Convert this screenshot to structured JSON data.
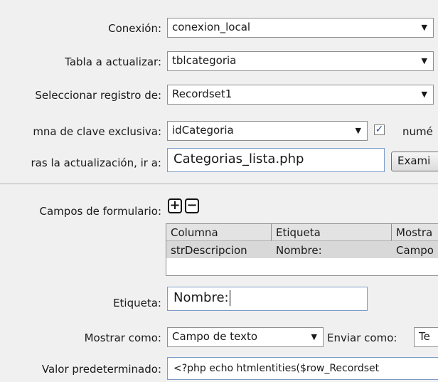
{
  "connection": {
    "label": "Conexión:",
    "value": "conexion_local"
  },
  "table": {
    "label": "Tabla a actualizar:",
    "value": "tblcategoria"
  },
  "recordset": {
    "label": "Seleccionar registro de:",
    "value": "Recordset1"
  },
  "key_column": {
    "label": "mna de clave exclusiva:",
    "value": "idCategoria",
    "numeric_label": "numé",
    "numeric_checked": true
  },
  "redirect": {
    "label": "ras la actualización, ir a:",
    "value": "Categorias_lista.php",
    "browse_label": "Exami"
  },
  "form_fields": {
    "label": "Campos de formulario:",
    "add_icon": "plus-icon",
    "remove_icon": "minus-icon",
    "columns": [
      "Columna",
      "Etiqueta",
      "Mostra"
    ],
    "rows": [
      [
        "strDescripcion",
        "Nombre:",
        "Campo"
      ]
    ]
  },
  "field_label": {
    "label": "Etiqueta:",
    "value": "Nombre:"
  },
  "display_as": {
    "label": "Mostrar como:",
    "value": "Campo de texto",
    "send_label": "Enviar como:",
    "send_value": "Te"
  },
  "default_value": {
    "label": "Valor predeterminado:",
    "value": "<?php echo htmlentities($row_Recordset"
  }
}
